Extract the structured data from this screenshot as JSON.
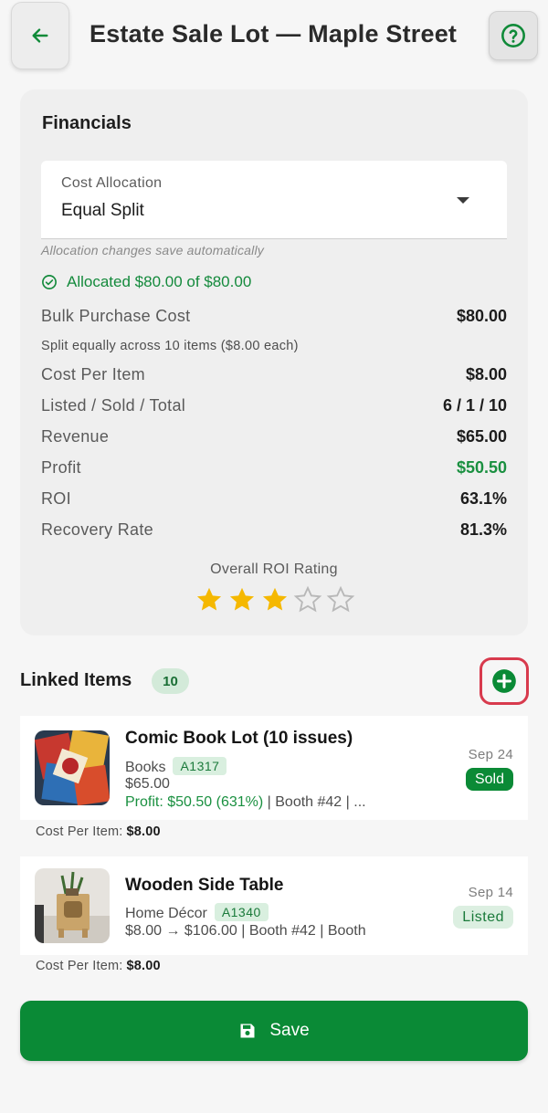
{
  "header": {
    "title": "Estate Sale Lot — Maple Street",
    "back_icon": "arrow-left-icon",
    "help_icon": "help-circle-icon"
  },
  "financials": {
    "title": "Financials",
    "select": {
      "label": "Cost Allocation",
      "value": "Equal Split"
    },
    "helper": "Allocation changes save automatically",
    "allocated": "Allocated $80.00 of $80.00",
    "rows": [
      {
        "label": "Bulk Purchase Cost",
        "value": "$80.00"
      },
      {
        "note": "Split equally across 10 items ($8.00 each)"
      },
      {
        "label": "Cost Per Item",
        "value": "$8.00"
      },
      {
        "label": "Listed / Sold / Total",
        "value": "6 / 1 / 10"
      },
      {
        "label": "Revenue",
        "value": "$65.00"
      },
      {
        "label": "Profit",
        "value": "$50.50"
      },
      {
        "label": "ROI",
        "value": "63.1%"
      },
      {
        "label": "Recovery Rate",
        "value": "81.3%"
      }
    ],
    "rating_label": "Overall ROI Rating",
    "rating": 3,
    "rating_max": 5
  },
  "linked": {
    "title": "Linked Items",
    "count": "10",
    "items": [
      {
        "title": "Comic Book Lot (10 issues)",
        "category": "Books",
        "sku": "A1317",
        "price": "$65.00",
        "profit": "Profit: $50.50 (631%)",
        "details": " | Booth #42 | ...",
        "date": "Sep 24",
        "status": "Sold",
        "cpi_label": "Cost Per Item:",
        "cpi_value": "$8.00"
      },
      {
        "title": "Wooden Side Table",
        "category": "Home Décor",
        "sku": "A1340",
        "price_line": "$8.00 → $106.00 | Booth #42 | Booth",
        "date": "Sep 14",
        "status": "Listed",
        "cpi_label": "Cost Per Item:",
        "cpi_value": "$8.00"
      }
    ]
  },
  "save_label": "Save",
  "colors": {
    "accent": "#0a8a36",
    "highlight": "#d83a4d",
    "star": "#f5b800"
  }
}
